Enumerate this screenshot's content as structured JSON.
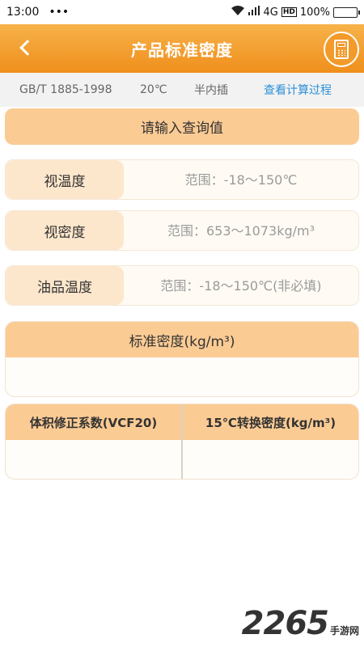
{
  "status": {
    "time": "13:00",
    "dots": "•••",
    "network": "4G",
    "hd": "HD",
    "battery": "100%",
    "battery_level": 1.0
  },
  "header": {
    "title": "产品标准密度",
    "back_icon": "chevron-left-icon",
    "calc_icon": "calculator-icon"
  },
  "info": {
    "standard": "GB/T 1885-1998",
    "temperature": "20℃",
    "method": "半内插",
    "link": "查看计算过程"
  },
  "banner": "请输入查询值",
  "inputs": [
    {
      "label": "视温度",
      "placeholder": "范围：-18～150℃"
    },
    {
      "label": "视密度",
      "placeholder": "范围：653～1073kg/m³"
    },
    {
      "label": "油品温度",
      "placeholder": "范围：-18～150℃(非必填)"
    }
  ],
  "result": {
    "title": "标准密度(kg/m³)",
    "value": ""
  },
  "columns": [
    {
      "title": "体积修正系数(VCF20)",
      "value": ""
    },
    {
      "title": "15℃转换密度(kg/m³)",
      "value": ""
    }
  ],
  "watermark": {
    "number": "2265",
    "text": "手游网"
  },
  "colors": {
    "accent": "#ef8f1c",
    "card_header": "#fbcb94",
    "link": "#2a8fd8"
  }
}
